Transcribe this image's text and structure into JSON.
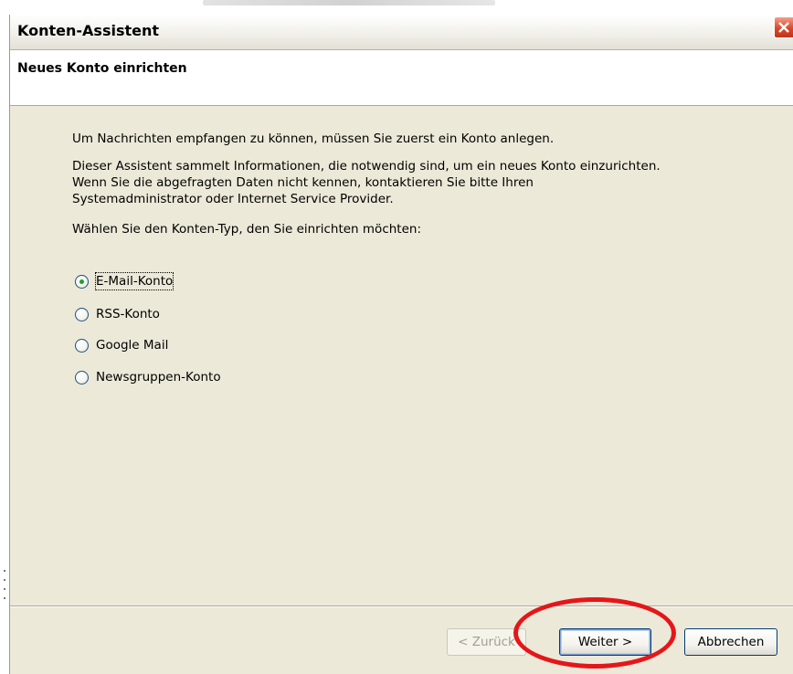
{
  "window": {
    "title": "Konten-Assistent"
  },
  "header": {
    "heading": "Neues Konto einrichten"
  },
  "content": {
    "intro": "Um Nachrichten empfangen zu können, müssen Sie zuerst ein Konto anlegen.",
    "info_line1": "Dieser Assistent sammelt Informationen, die notwendig sind, um ein neues Konto einzurichten.",
    "info_line2": "Wenn Sie die abgefragten Daten nicht kennen, kontaktieren Sie bitte Ihren",
    "info_line3": "Systemadministrator oder Internet Service Provider.",
    "prompt": "Wählen Sie den Konten-Typ, den Sie einrichten möchten:",
    "account_types": [
      {
        "label": "E-Mail-Konto",
        "selected": true
      },
      {
        "label": "RSS-Konto",
        "selected": false
      },
      {
        "label": "Google Mail",
        "selected": false
      },
      {
        "label": "Newsgruppen-Konto",
        "selected": false
      }
    ]
  },
  "buttons": {
    "back": "< Zurück",
    "next": "Weiter >",
    "cancel": "Abbrechen"
  },
  "colors": {
    "dialog_bg": "#ece9d8",
    "annotation": "#e5161a",
    "selected_dot": "#21a121"
  },
  "icons": {
    "close": "close-icon"
  }
}
